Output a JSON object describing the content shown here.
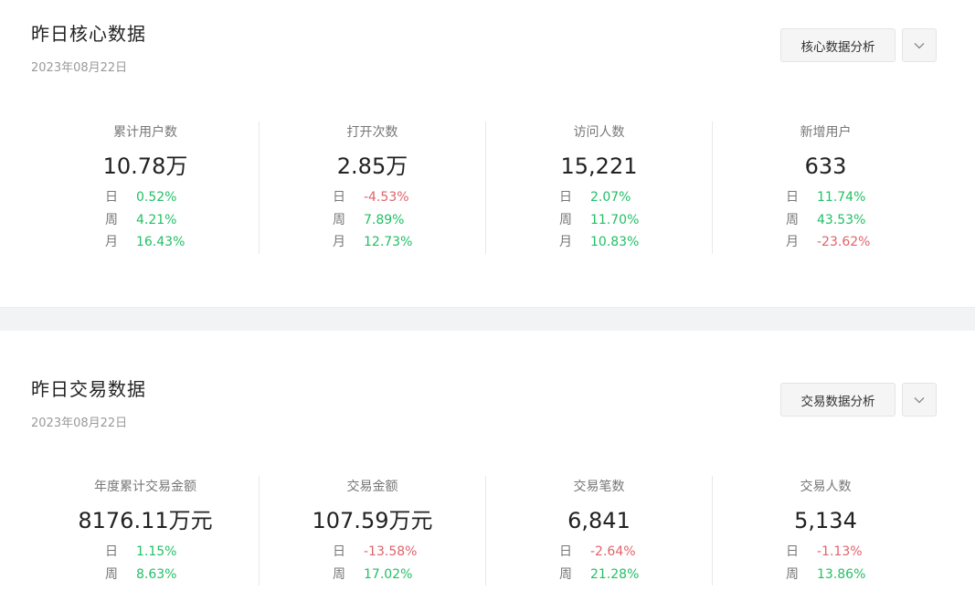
{
  "core": {
    "title": "昨日核心数据",
    "date": "2023年08月22日",
    "analysis_label": "核心数据分析",
    "metrics": [
      {
        "label": "累计用户数",
        "value": "10.78万",
        "day": "0.52%",
        "week": "4.21%",
        "month": "16.43%"
      },
      {
        "label": "打开次数",
        "value": "2.85万",
        "day": "-4.53%",
        "week": "7.89%",
        "month": "12.73%"
      },
      {
        "label": "访问人数",
        "value": "15,221",
        "day": "2.07%",
        "week": "11.70%",
        "month": "10.83%"
      },
      {
        "label": "新增用户",
        "value": "633",
        "day": "11.74%",
        "week": "43.53%",
        "month": "-23.62%"
      }
    ]
  },
  "trade": {
    "title": "昨日交易数据",
    "date": "2023年08月22日",
    "analysis_label": "交易数据分析",
    "metrics": [
      {
        "label": "年度累计交易金额",
        "value": "8176.11万元",
        "day": "1.15%",
        "week": "8.63%"
      },
      {
        "label": "交易金额",
        "value": "107.59万元",
        "day": "-13.58%",
        "week": "17.02%"
      },
      {
        "label": "交易笔数",
        "value": "6,841",
        "day": "-2.64%",
        "week": "21.28%"
      },
      {
        "label": "交易人数",
        "value": "5,134",
        "day": "-1.13%",
        "week": "13.86%"
      }
    ]
  },
  "period_labels": {
    "day": "日",
    "week": "周",
    "month": "月"
  },
  "colors": {
    "positive": "#22c065",
    "negative": "#e0636a"
  },
  "icons": {
    "dropdown": "chevron-down-icon"
  }
}
